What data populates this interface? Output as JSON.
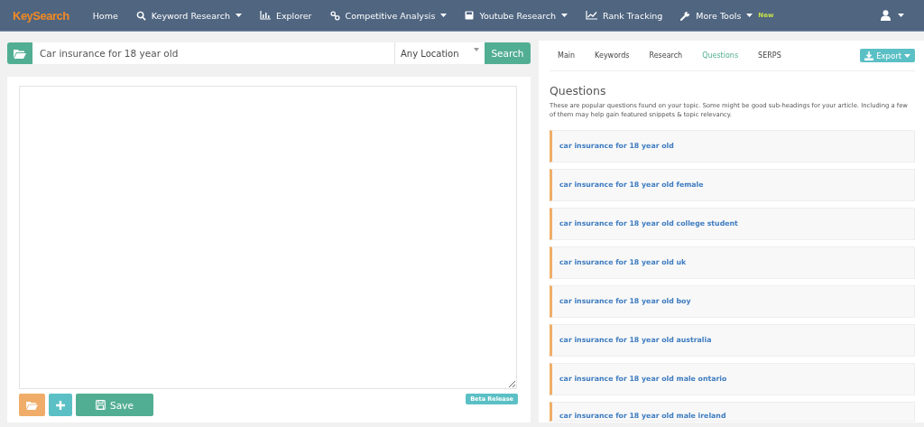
{
  "navbar": {
    "logo": "KeySearch",
    "items": [
      {
        "label": "Home",
        "kind": "plain",
        "dropdown": false
      },
      {
        "label": "Keyword Research",
        "kind": "search",
        "dropdown": true
      },
      {
        "label": "Explorer",
        "kind": "chart",
        "dropdown": false
      },
      {
        "label": "Competitive Analysis",
        "kind": "link",
        "dropdown": true
      },
      {
        "label": "Youtube Research",
        "kind": "disk",
        "dropdown": true
      },
      {
        "label": "Rank Tracking",
        "kind": "line",
        "dropdown": false
      },
      {
        "label": "More Tools",
        "kind": "wrench",
        "dropdown": true,
        "badge": "New"
      }
    ]
  },
  "search": {
    "value": "Car insurance for 18 year old",
    "location": "Any Location",
    "button": "Search"
  },
  "editor": {
    "buttons": [
      {
        "kind": "open"
      },
      {
        "kind": "add"
      },
      {
        "kind": "save",
        "label": "Save"
      }
    ],
    "badge": "Beta Release"
  },
  "tabs": [
    {
      "label": "Main",
      "selected": false
    },
    {
      "label": "Keywords",
      "selected": false
    },
    {
      "label": "Research",
      "selected": false
    },
    {
      "label": "Questions",
      "selected": true
    },
    {
      "label": "SERPS",
      "selected": false
    }
  ],
  "export": "Export",
  "questions": {
    "title": "Questions",
    "description": "These are popular questions found on your topic. Some might be good sub-headings for your article. Including a few of them may help gain featured snippets & topic relevancy.",
    "items": [
      "car insurance for 18 year old",
      "car insurance for 18 year old female",
      "car insurance for 18 year old college student",
      "car insurance for 18 year old uk",
      "car insurance for 18 year old boy",
      "car insurance for 18 year old australia",
      "car insurance for 18 year old male ontario",
      "car insurance for 18 year old male ireland"
    ]
  }
}
